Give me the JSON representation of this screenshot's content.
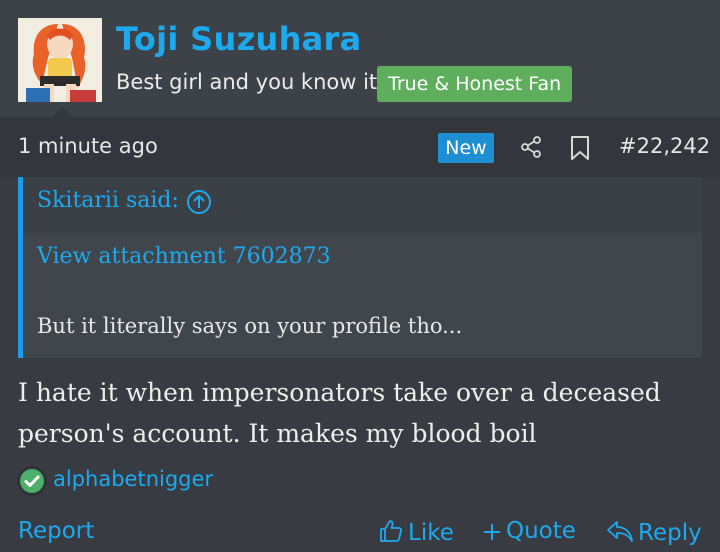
{
  "post": {
    "author": "Toji Suzuhara",
    "user_title": "Best girl and you know it",
    "user_banner": "True & Honest Fan",
    "timestamp": "1 minute ago",
    "new_badge": "New",
    "post_number": "#22,242",
    "quote": {
      "author": "Skitarii said:",
      "attachment": "View attachment 7602873",
      "text": "But it literally says on your profile tho..."
    },
    "message_lines": [
      "I hate it when impersonators take over a deceased",
      "person's account. It makes my blood boil"
    ],
    "reaction": {
      "user": "alphabetnigger",
      "icon": "check-circle-icon"
    }
  },
  "actions": {
    "report": "Report",
    "like": "Like",
    "quote": "Quote",
    "reply": "Reply"
  },
  "colors": {
    "link": "#1da9ee",
    "banner_green": "#5fae5e",
    "new_blue": "#1f8fd3",
    "quote_bar": "#1b9de9"
  }
}
